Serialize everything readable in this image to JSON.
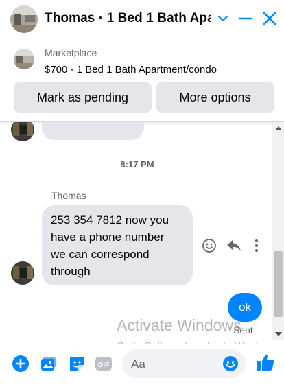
{
  "header": {
    "title": "Thomas · 1 Bed 1 Bath Apa…",
    "avatar_icon": "apartment-photo-icon",
    "chevron_icon": "chevron-down-icon",
    "minimize_icon": "minimize-icon",
    "close_icon": "close-icon"
  },
  "marketplace": {
    "label": "Marketplace",
    "listing": "$700 - 1 Bed 1 Bath Apartment/condo",
    "mark_pending": "Mark as pending",
    "more_options": "More options"
  },
  "thread": {
    "timestamp": "8:17 PM",
    "sender": "Thomas",
    "message_lines": [
      "253 354 7812 now you",
      "have a phone number",
      "we can correspond",
      "through"
    ],
    "reply": "ok",
    "reply_status": "Sent"
  },
  "watermark": {
    "line1": "Activate Windows",
    "line2": "Go to Settings to activate Windows."
  },
  "composer": {
    "placeholder": "Aa",
    "icons": [
      "plus-icon",
      "image-icon",
      "sticker-icon",
      "gif-icon",
      "emoji-icon",
      "thumbs-up-icon"
    ]
  },
  "colors": {
    "accent": "#0084ff",
    "button_bg": "#e4e6eb",
    "secondary_text": "#65676b"
  }
}
